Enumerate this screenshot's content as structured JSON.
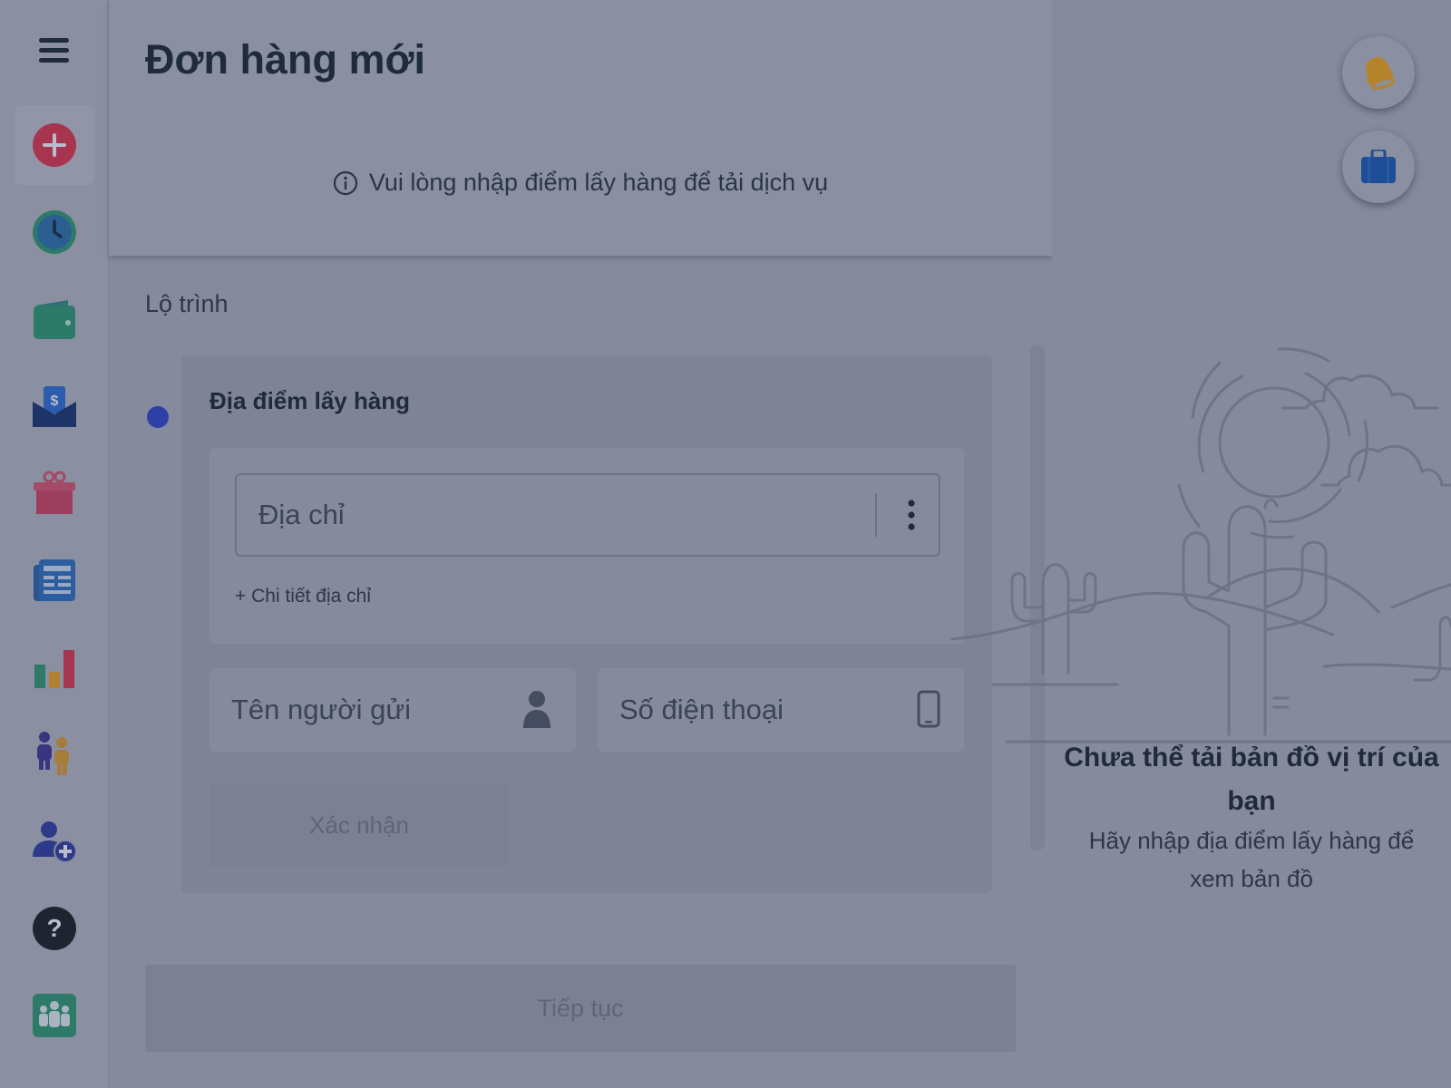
{
  "header": {
    "title": "Đơn hàng mới",
    "notice": "Vui lòng nhập điểm lấy hàng để tải dịch vụ"
  },
  "sidebar": {
    "items": [
      {
        "icon": "plus-circle-icon",
        "color": "#a8354f",
        "active": true
      },
      {
        "icon": "clock-icon",
        "color": "#2c6e9a"
      },
      {
        "icon": "wallet-icon",
        "color": "#2e7a68"
      },
      {
        "icon": "money-envelope-icon",
        "color": "#1e3366"
      },
      {
        "icon": "gift-icon",
        "color": "#a24a66"
      },
      {
        "icon": "newspaper-icon",
        "color": "#285a94"
      },
      {
        "icon": "bar-chart-icon",
        "color": "#2e7a68"
      },
      {
        "icon": "people-icon",
        "color": "#3b3480"
      },
      {
        "icon": "add-user-icon",
        "color": "#2d3a8a"
      },
      {
        "icon": "help-icon",
        "color": "#1f2430"
      },
      {
        "icon": "team-icon",
        "color": "#2e7a68"
      }
    ]
  },
  "route": {
    "label": "Lộ trình",
    "pickup": {
      "title": "Địa điểm lấy hàng",
      "address_placeholder": "Địa chỉ",
      "address_detail_link": "+ Chi tiết địa chỉ",
      "sender_name_placeholder": "Tên người gửi",
      "phone_placeholder": "Số điện thoại",
      "confirm_label": "Xác nhận"
    }
  },
  "continue_label": "Tiếp tục",
  "map": {
    "empty_title": "Chưa thể tải bản đồ vị trí của bạn",
    "empty_subtitle": "Hãy nhập địa điểm lấy hàng để xem bản đồ"
  },
  "fabs": [
    {
      "icon": "bell-icon",
      "color": "#b5842a"
    },
    {
      "icon": "briefcase-icon",
      "color": "#1e4e96"
    }
  ]
}
